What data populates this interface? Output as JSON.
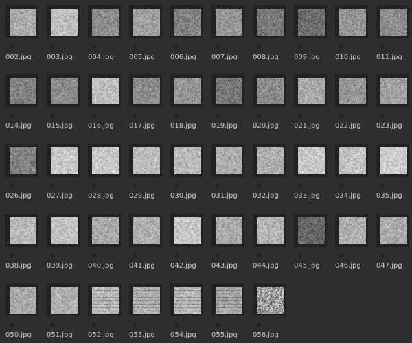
{
  "files": [
    "002.jpg",
    "003.jpg",
    "004.jpg",
    "005.jpg",
    "006.jpg",
    "007.jpg",
    "008.jpg",
    "009.jpg",
    "010.jpg",
    "011.jpg",
    "014.jpg",
    "015.jpg",
    "016.jpg",
    "017.jpg",
    "018.jpg",
    "019.jpg",
    "020.jpg",
    "021.jpg",
    "022.jpg",
    "023.jpg",
    "026.jpg",
    "027.jpg",
    "028.jpg",
    "029.jpg",
    "030.jpg",
    "031.jpg",
    "032.jpg",
    "033.jpg",
    "034.jpg",
    "035.jpg",
    "038.jpg",
    "039.jpg",
    "040.jpg",
    "041.jpg",
    "042.jpg",
    "043.jpg",
    "044.jpg",
    "045.jpg",
    "046.jpg",
    "047.jpg",
    "050.jpg",
    "051.jpg",
    "052.jpg",
    "053.jpg",
    "054.jpg",
    "055.jpg",
    "056.jpg"
  ],
  "star_icon": "star-icon",
  "colors": {
    "background": "#2e2e2e",
    "frame": "#222222",
    "label": "#c9c9c9"
  }
}
